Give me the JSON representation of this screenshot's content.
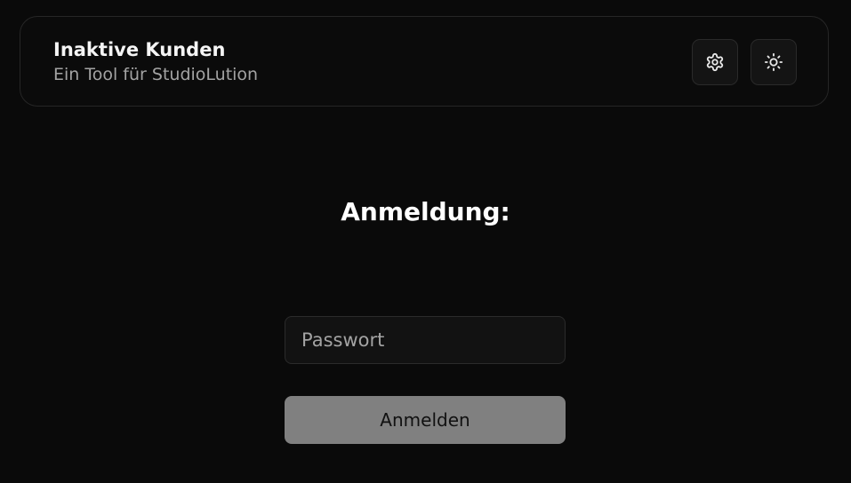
{
  "header": {
    "title": "Inaktive Kunden",
    "subtitle": "Ein Tool für StudioLution",
    "buttons": [
      {
        "icon": "gear-icon",
        "label": "Einstellungen"
      },
      {
        "icon": "sun-icon",
        "label": "Design umschalten"
      }
    ]
  },
  "login": {
    "heading": "Anmeldung:",
    "password_placeholder": "Passwort",
    "password_value": "",
    "submit_label": "Anmelden"
  },
  "colors": {
    "background": "#0a0a0a",
    "border": "#262626",
    "input_background": "#121212",
    "button_background": "#808080",
    "text_muted": "#a3a3a3"
  }
}
